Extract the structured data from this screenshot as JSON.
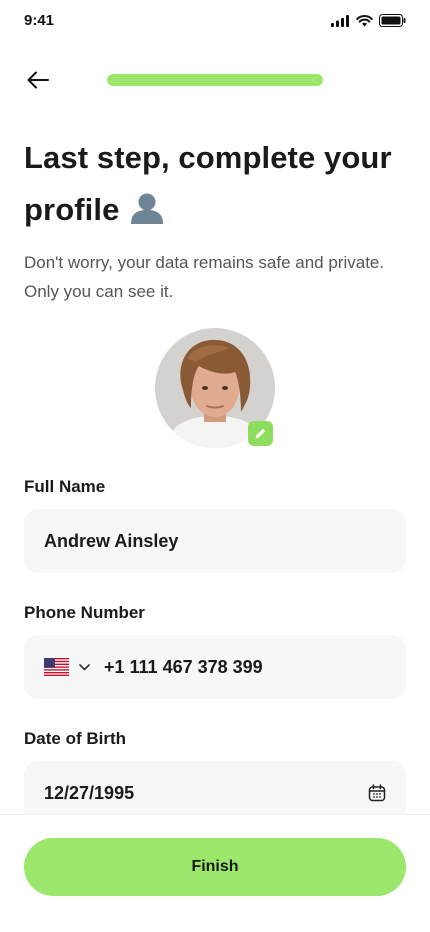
{
  "status_bar": {
    "time": "9:41"
  },
  "progress": {
    "value": 1.0
  },
  "header": {
    "title": "Last step, complete your profile",
    "subtitle": "Don't worry, your data remains safe and private. Only you can see it."
  },
  "form": {
    "full_name": {
      "label": "Full Name",
      "value": "Andrew Ainsley"
    },
    "phone": {
      "label": "Phone Number",
      "country": "US",
      "value": "+1 111 467 378 399"
    },
    "dob": {
      "label": "Date of Birth",
      "value": "12/27/1995"
    }
  },
  "actions": {
    "finish_label": "Finish"
  },
  "colors": {
    "accent": "#9be76c",
    "field_bg": "#f7f7f7",
    "text": "#1a1a1a"
  }
}
